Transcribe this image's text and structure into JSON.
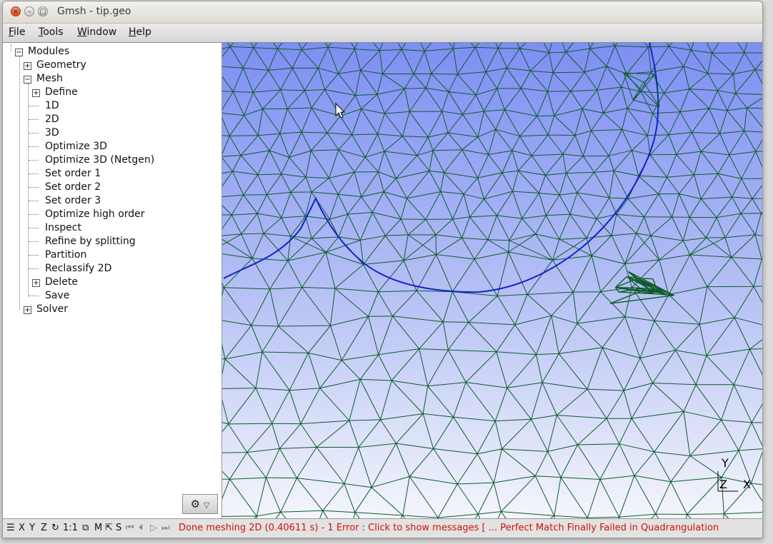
{
  "window": {
    "title": "Gmsh - tip.geo"
  },
  "menu": {
    "file": "File",
    "tools": "Tools",
    "window": "Window",
    "help": "Help"
  },
  "tree": {
    "modules": "Modules",
    "geometry": "Geometry",
    "mesh": "Mesh",
    "mesh_items": [
      "Define",
      "1D",
      "2D",
      "3D",
      "Optimize 3D",
      "Optimize 3D (Netgen)",
      "Set order 1",
      "Set order 2",
      "Set order 3",
      "Optimize high order",
      "Inspect",
      "Refine by splitting",
      "Partition",
      "Reclassify 2D",
      "Delete",
      "Save"
    ],
    "solver": "Solver"
  },
  "toolbar": {
    "x": "X",
    "y": "Y",
    "z": "Z",
    "one_to_one": "1:1",
    "m": "M",
    "s": "S"
  },
  "status": {
    "message": "Done meshing 2D (0.40611 s)  -  1 Error : Click to show messages [ ... Perfect Match Finally Failed in Quadrangulation"
  },
  "axes": {
    "y": "Y",
    "z": "Z",
    "x": "X"
  },
  "colors": {
    "mesh_line": "#0d5b2c",
    "curve": "#1024c8",
    "status_error": "#d01010"
  }
}
